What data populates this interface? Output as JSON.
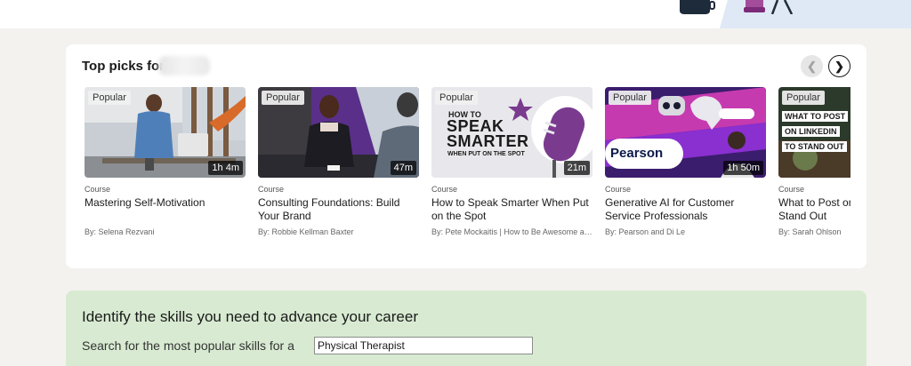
{
  "picks": {
    "title": "Top picks for",
    "prev_icon": "chevron-left-icon",
    "next_icon": "chevron-right-icon",
    "courses": [
      {
        "badge": "Popular",
        "duration": "1h 4m",
        "type": "Course",
        "title": "Mastering Self-Motivation",
        "author": "By: Selena Rezvani"
      },
      {
        "badge": "Popular",
        "duration": "47m",
        "type": "Course",
        "title": "Consulting Foundations: Build Your Brand",
        "author": "By: Robbie Kellman Baxter"
      },
      {
        "badge": "Popular",
        "duration": "21m",
        "type": "Course",
        "title": "How to Speak Smarter When Put on the Spot",
        "author": "By: Pete Mockaitis | How to Be Awesome at ...",
        "thumb_text": [
          "HOW TO",
          "SPEAK",
          "SMARTER",
          "WHEN PUT ON THE SPOT"
        ]
      },
      {
        "badge": "Popular",
        "duration": "1h 50m",
        "type": "Course",
        "title": "Generative AI for Customer Service Professionals",
        "author": "By: Pearson and Di Le",
        "thumb_text": [
          "Pearson"
        ]
      },
      {
        "badge": "Popular",
        "duration": "",
        "type": "Course",
        "title": "What to Post on LinkedIn to Stand Out",
        "author": "By: Sarah Ohlson",
        "thumb_text": [
          "WHAT TO POST",
          "ON LINKEDIN",
          "TO STAND OUT"
        ]
      }
    ]
  },
  "skills": {
    "title": "Identify the skills you need to advance your career",
    "prompt": "Search for the most popular skills for a",
    "input_value": "Physical Therapist"
  },
  "colors": {
    "skills_bg": "#d8ebd2",
    "speak_accent": "#7a3b8f",
    "ai_purple": "#6b2fc4"
  }
}
